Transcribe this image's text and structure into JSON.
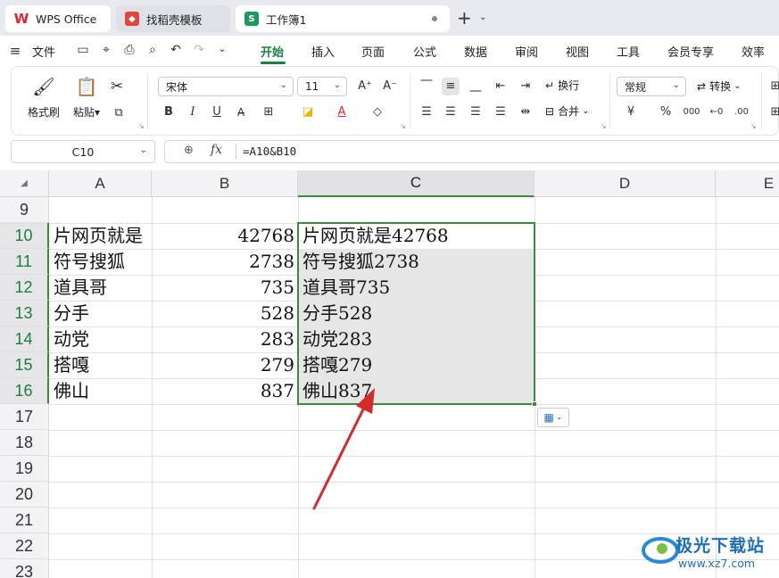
{
  "tabs": [
    {
      "label": "WPS Office"
    },
    {
      "label": "找稻壳模板"
    },
    {
      "label": "工作簿1"
    }
  ],
  "menu": {
    "file": "文件",
    "items": [
      "开始",
      "插入",
      "页面",
      "公式",
      "数据",
      "审阅",
      "视图",
      "工具",
      "会员专享",
      "效率"
    ]
  },
  "ribbon": {
    "format_painter": "格式刷",
    "paste": "粘贴",
    "font_name": "宋体",
    "font_size": "11",
    "wrap": "换行",
    "merge": "合并",
    "number_format": "常规",
    "convert": "转换",
    "yen": "¥",
    "percent": "%"
  },
  "formula_bar": {
    "name_box": "C10",
    "fx": "fx",
    "formula": "=A10&B10"
  },
  "sheet": {
    "columns": [
      "A",
      "B",
      "C",
      "D",
      "E"
    ],
    "rows": [
      "9",
      "10",
      "11",
      "12",
      "13",
      "14",
      "15",
      "16",
      "17",
      "18",
      "19",
      "20",
      "21",
      "22",
      "23"
    ],
    "data": [
      {
        "a": "片网页就是",
        "b": "42768",
        "c": "片网页就是42768"
      },
      {
        "a": "符号搜狐",
        "b": "2738",
        "c": "符号搜狐2738"
      },
      {
        "a": "道具哥",
        "b": "735",
        "c": "道具哥735"
      },
      {
        "a": "分手",
        "b": "528",
        "c": "分手528"
      },
      {
        "a": "动党",
        "b": "283",
        "c": "动党283"
      },
      {
        "a": "搭嘎",
        "b": "279",
        "c": "搭嘎279"
      },
      {
        "a": "佛山",
        "b": "837",
        "c": "佛山837"
      }
    ]
  },
  "watermark": {
    "title": "极光下载站",
    "url": "www.xz7.com"
  },
  "colors": {
    "accent": "#1a7f43",
    "selection": "#3b8a3e",
    "arrow": "#d42a2a"
  }
}
